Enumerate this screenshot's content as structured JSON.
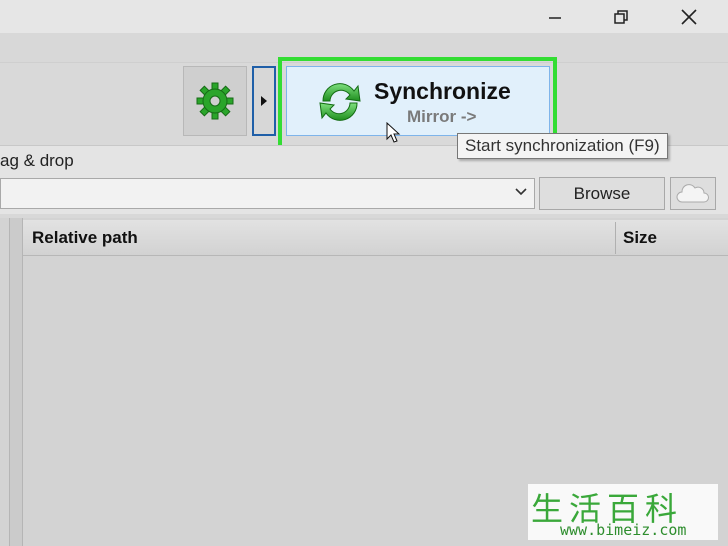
{
  "window": {
    "minimize_icon": "minimize-icon",
    "restore_icon": "restore-icon",
    "close_icon": "close-icon"
  },
  "toolbar": {
    "settings_icon": "gear-icon",
    "expand_icon": "triangle-right-icon",
    "sync_button": {
      "icon": "sync-arrows-icon",
      "title": "Synchronize",
      "subtitle": "Mirror ->"
    },
    "tooltip": "Start synchronization (F9)"
  },
  "folder_panel": {
    "drag_label": "ag & drop",
    "path_value": "",
    "browse_label": "Browse",
    "cloud_icon": "cloud-icon"
  },
  "file_grid": {
    "columns": [
      "Relative path",
      "Size"
    ]
  },
  "watermark": {
    "chars": "生活百科",
    "url": "www.bimeiz.com"
  },
  "colors": {
    "highlight": "#33dd33",
    "sync_button_bg": "#e1f0fb",
    "gear_green": "#2aa52a",
    "expand_border": "#1f5fa8"
  }
}
